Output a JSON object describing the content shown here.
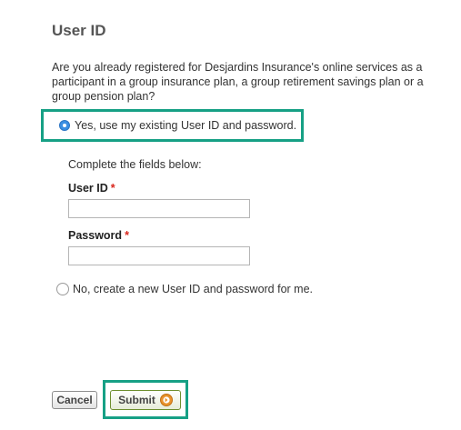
{
  "page": {
    "title": "User ID",
    "question": "Are you already registered for Desjardins Insurance's online services as a participant in a group insurance plan, a group retirement savings plan or a group pension plan?"
  },
  "options": {
    "yes_label": "Yes, use my existing User ID and password.",
    "yes_selected": true,
    "no_label": "No, create a new User ID and password for me.",
    "no_selected": false
  },
  "form": {
    "instructions": "Complete the fields below:",
    "user_id_label": "User ID",
    "password_label": "Password",
    "required_marker": "*",
    "user_id_value": "",
    "password_value": ""
  },
  "buttons": {
    "cancel_label": "Cancel",
    "submit_label": "Submit"
  },
  "colors": {
    "highlight_border": "#16a085",
    "radio_selected": "#3b8fe3",
    "required_marker": "#d9261c",
    "submit_arrow": "#e8922b"
  },
  "icons": {
    "submit": "arrow-circle-right-icon"
  }
}
